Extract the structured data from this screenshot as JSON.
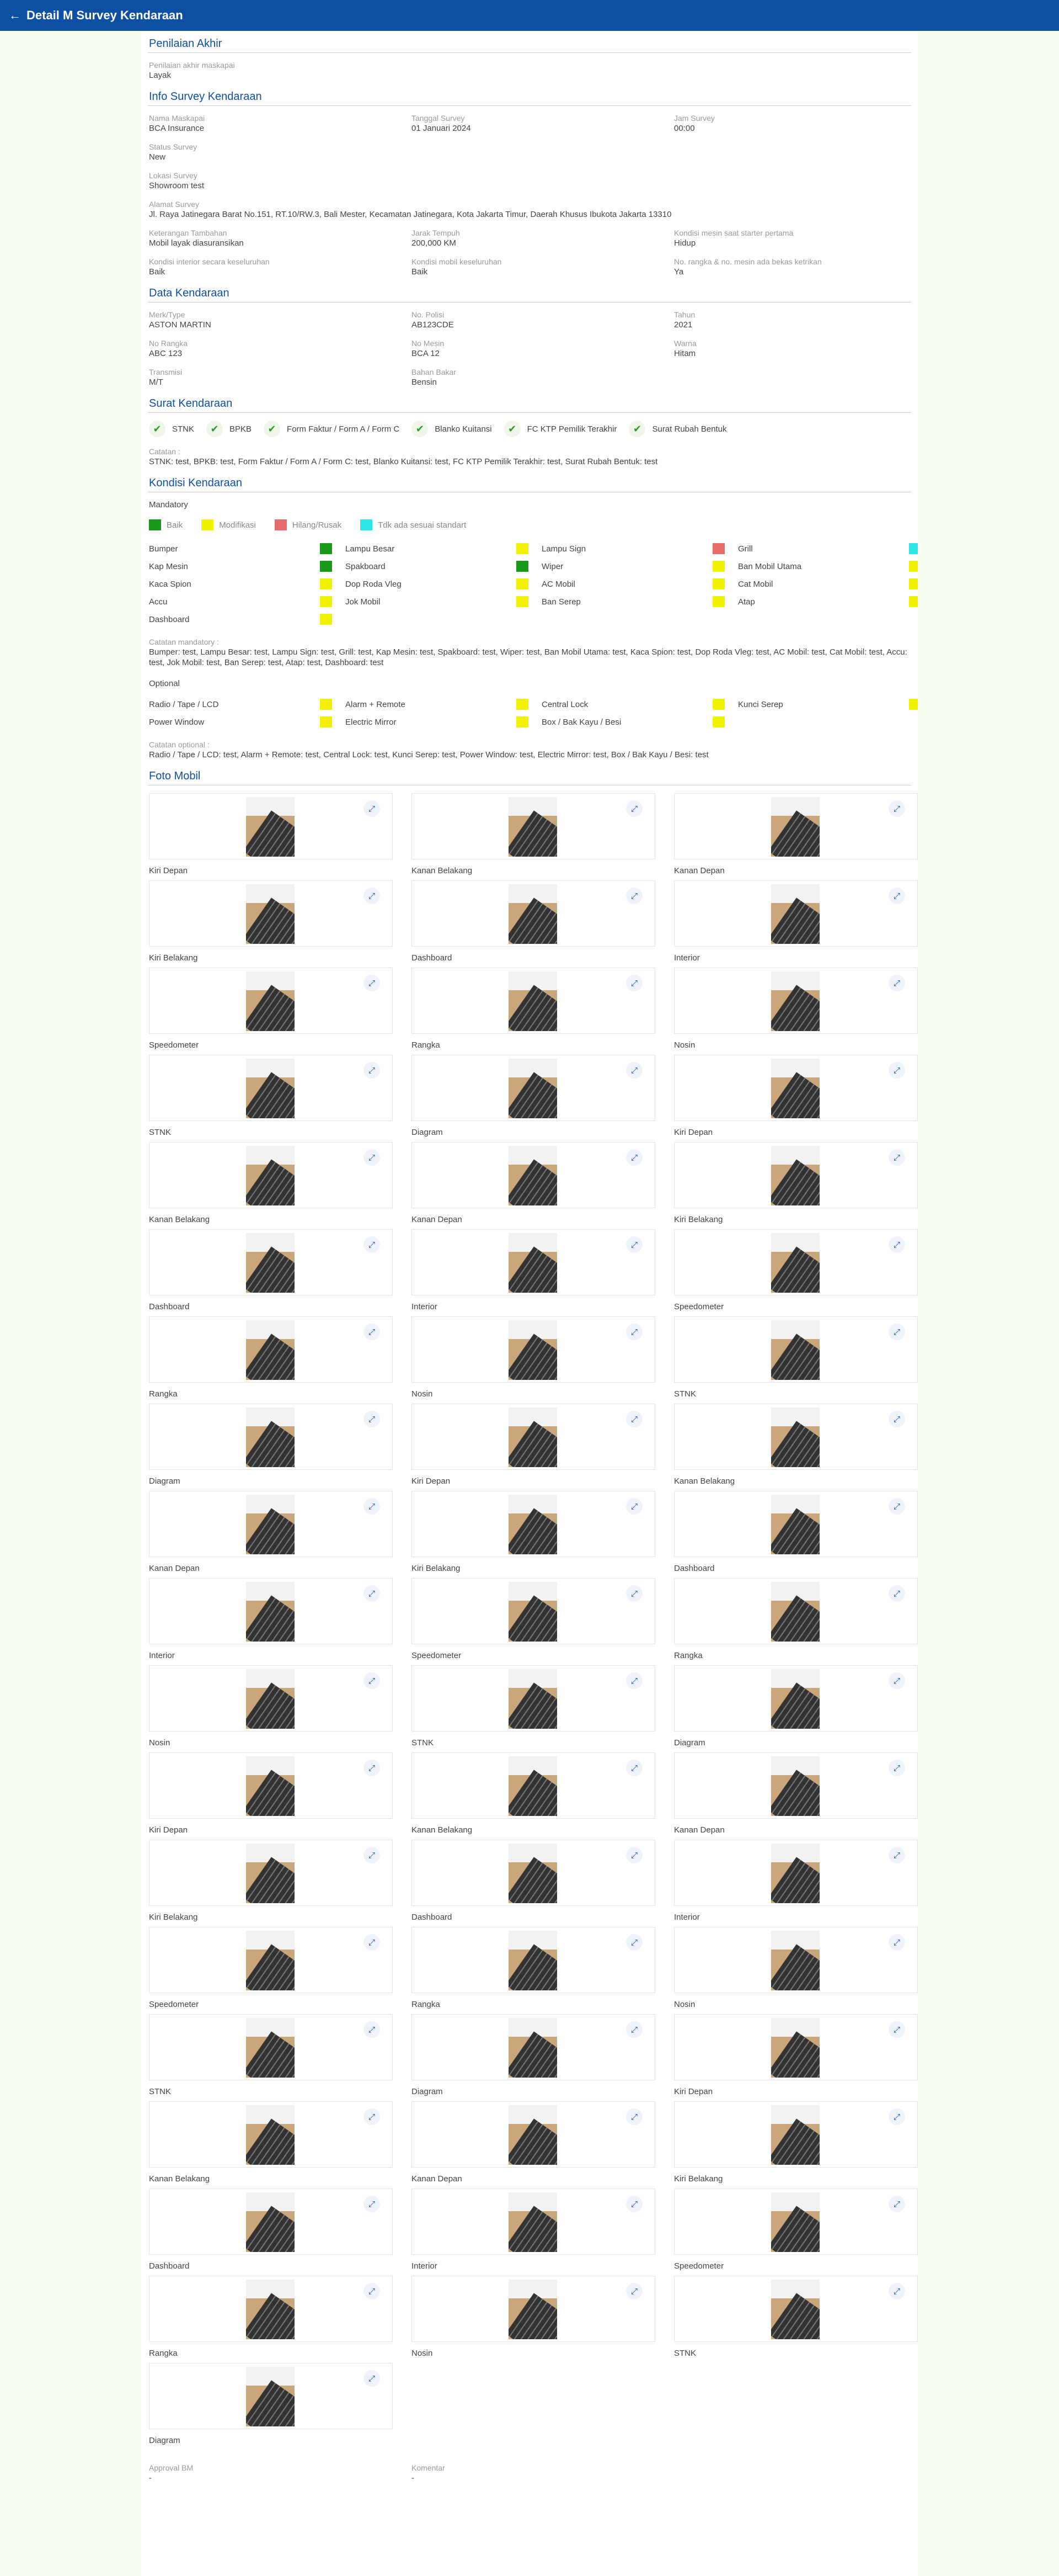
{
  "header": {
    "back_icon": "arrow-left-icon",
    "title": "Detail M Survey Kendaraan"
  },
  "penilaian": {
    "section": "Penilaian Akhir",
    "label": "Penilaian akhir maskapai",
    "value": "Layak"
  },
  "info": {
    "section": "Info Survey Kendaraan",
    "rows": [
      [
        {
          "label": "Nama Maskapai",
          "value": "BCA Insurance"
        },
        {
          "label": "Tanggal Survey",
          "value": "01 Januari 2024"
        },
        {
          "label": "Jam Survey",
          "value": "00:00"
        }
      ],
      [
        {
          "label": "Status Survey",
          "value": "New"
        }
      ],
      [
        {
          "label": "Lokasi Survey",
          "value": "Showroom test"
        }
      ],
      [
        {
          "label": "Alamat Survey",
          "value": "Jl. Raya Jatinegara Barat No.151, RT.10/RW.3, Bali Mester, Kecamatan Jatinegara, Kota Jakarta Timur, Daerah Khusus Ibukota Jakarta 13310"
        }
      ],
      [
        {
          "label": "Keterangan Tambahan",
          "value": "Mobil layak diasuransikan"
        },
        {
          "label": "Jarak Tempuh",
          "value": "200,000 KM"
        },
        {
          "label": "Kondisi mesin saat starter pertama",
          "value": "Hidup"
        }
      ],
      [
        {
          "label": "Kondisi interior secara keseluruhan",
          "value": "Baik"
        },
        {
          "label": "Kondisi mobil keseluruhan",
          "value": "Baik"
        },
        {
          "label": "No. rangka & no. mesin ada bekas ketrikan",
          "value": "Ya"
        }
      ]
    ]
  },
  "kendaraan": {
    "section": "Data Kendaraan",
    "rows": [
      [
        {
          "label": "Merk/Type",
          "value": "ASTON MARTIN"
        },
        {
          "label": "No. Polisi",
          "value": "AB123CDE"
        },
        {
          "label": "Tahun",
          "value": "2021"
        }
      ],
      [
        {
          "label": "No Rangka",
          "value": "ABC 123"
        },
        {
          "label": "No Mesin",
          "value": "BCA 12"
        },
        {
          "label": "Warna",
          "value": "Hitam"
        }
      ],
      [
        {
          "label": "Transmisi",
          "value": "M/T"
        },
        {
          "label": "Bahan Bakar",
          "value": "Bensin"
        }
      ]
    ]
  },
  "surat": {
    "section": "Surat Kendaraan",
    "items": [
      "STNK",
      "BPKB",
      "Form Faktur / Form A / Form C",
      "Blanko Kuitansi",
      "FC KTP Pemilik Terakhir",
      "Surat Rubah Bentuk"
    ],
    "check_icon": "check-icon",
    "catatan_label": "Catatan :",
    "catatan_value": "STNK: test, BPKB: test, Form Faktur / Form A / Form C: test, Blanko Kuitansi: test, FC KTP Pemilik Terakhir: test, Surat Rubah Bentuk: test"
  },
  "kondisi": {
    "section": "Kondisi Kendaraan",
    "mandatory_title": "Mandatory",
    "legend": [
      {
        "label": "Baik",
        "color": "#1a9a1a"
      },
      {
        "label": "Modifikasi",
        "color": "#f2f200"
      },
      {
        "label": "Hilang/Rusak",
        "color": "#e86b6b"
      },
      {
        "label": "Tdk ada sesuai standart",
        "color": "#2ee8e8"
      }
    ],
    "mandatory": [
      {
        "label": "Bumper",
        "color": "#1a9a1a"
      },
      {
        "label": "Lampu Besar",
        "color": "#f2f200"
      },
      {
        "label": "Lampu Sign",
        "color": "#e86b6b"
      },
      {
        "label": "Grill",
        "color": "#2ee8e8"
      },
      {
        "label": "Kap Mesin",
        "color": "#1a9a1a"
      },
      {
        "label": "Spakboard",
        "color": "#1a9a1a"
      },
      {
        "label": "Wiper",
        "color": "#f2f200"
      },
      {
        "label": "Ban Mobil Utama",
        "color": "#f2f200"
      },
      {
        "label": "Kaca Spion",
        "color": "#f2f200"
      },
      {
        "label": "Dop Roda Vleg",
        "color": "#f2f200"
      },
      {
        "label": "AC Mobil",
        "color": "#f2f200"
      },
      {
        "label": "Cat Mobil",
        "color": "#f2f200"
      },
      {
        "label": "Accu",
        "color": "#f2f200"
      },
      {
        "label": "Jok Mobil",
        "color": "#f2f200"
      },
      {
        "label": "Ban Serep",
        "color": "#f2f200"
      },
      {
        "label": "Atap",
        "color": "#f2f200"
      },
      {
        "label": "Dashboard",
        "color": "#f2f200"
      }
    ],
    "catatan_mandatory_label": "Catatan mandatory :",
    "catatan_mandatory_value": "Bumper: test, Lampu Besar: test, Lampu Sign: test, Grill: test, Kap Mesin: test, Spakboard: test, Wiper: test, Ban Mobil Utama: test, Kaca Spion: test, Dop Roda Vleg: test, AC Mobil: test, Cat Mobil: test, Accu: test, Jok Mobil: test, Ban Serep: test, Atap: test, Dashboard: test",
    "optional_title": "Optional",
    "optional": [
      {
        "label": "Radio / Tape / LCD",
        "color": "#f2f200"
      },
      {
        "label": "Alarm + Remote",
        "color": "#f2f200"
      },
      {
        "label": "Central Lock",
        "color": "#f2f200"
      },
      {
        "label": "Kunci Serep",
        "color": "#f2f200"
      },
      {
        "label": "Power Window",
        "color": "#f2f200"
      },
      {
        "label": "Electric Mirror",
        "color": "#f2f200"
      },
      {
        "label": "Box / Bak Kayu / Besi",
        "color": "#f2f200"
      }
    ],
    "catatan_optional_label": "Catatan optional :",
    "catatan_optional_value": "Radio / Tape / LCD: test, Alarm + Remote: test, Central Lock: test, Kunci Serep: test, Power Window: test, Electric Mirror: test, Box / Bak Kayu / Besi: test"
  },
  "foto": {
    "section": "Foto Mobil",
    "zoom_icon": "expand-icon",
    "captions": [
      "Kiri Depan",
      "Kanan Belakang",
      "Kanan Depan",
      "Kiri Belakang",
      "Dashboard",
      "Interior",
      "Speedometer",
      "Rangka",
      "Nosin",
      "STNK",
      "Diagram",
      "Kiri Depan",
      "Kanan Belakang",
      "Kanan Depan",
      "Kiri Belakang",
      "Dashboard",
      "Interior",
      "Speedometer",
      "Rangka",
      "Nosin",
      "STNK",
      "Diagram",
      "Kiri Depan",
      "Kanan Belakang",
      "Kanan Depan",
      "Kiri Belakang",
      "Dashboard",
      "Interior",
      "Speedometer",
      "Rangka",
      "Nosin",
      "STNK",
      "Diagram",
      "Kiri Depan",
      "Kanan Belakang",
      "Kanan Depan",
      "Kiri Belakang",
      "Dashboard",
      "Interior",
      "Speedometer",
      "Rangka",
      "Nosin",
      "STNK",
      "Diagram",
      "Kiri Depan",
      "Kanan Belakang",
      "Kanan Depan",
      "Kiri Belakang",
      "Dashboard",
      "Interior",
      "Speedometer",
      "Rangka",
      "Nosin",
      "STNK",
      "Diagram"
    ]
  },
  "footer": {
    "approval_label": "Approval BM",
    "approval_value": "-",
    "komentar_label": "Komentar",
    "komentar_value": "-"
  }
}
